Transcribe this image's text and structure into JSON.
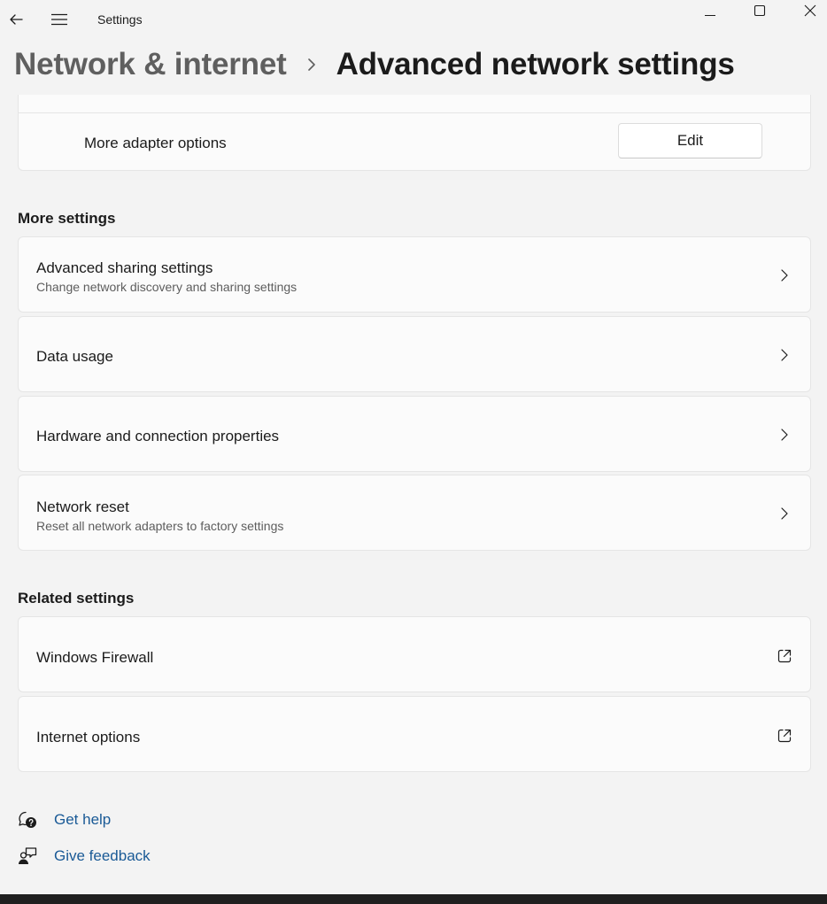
{
  "window": {
    "app_title": "Settings"
  },
  "breadcrumb": {
    "parent": "Network & internet",
    "current": "Advanced network settings"
  },
  "adapter": {
    "label": "More adapter options",
    "edit_label": "Edit"
  },
  "more_settings": {
    "heading": "More settings",
    "items": [
      {
        "title": "Advanced sharing settings",
        "subtitle": "Change network discovery and sharing settings",
        "icon": "chevron-right-icon"
      },
      {
        "title": "Data usage",
        "subtitle": "",
        "icon": "chevron-right-icon"
      },
      {
        "title": "Hardware and connection properties",
        "subtitle": "",
        "icon": "chevron-right-icon"
      },
      {
        "title": "Network reset",
        "subtitle": "Reset all network adapters to factory settings",
        "icon": "chevron-right-icon"
      }
    ]
  },
  "related_settings": {
    "heading": "Related settings",
    "items": [
      {
        "title": "Windows Firewall",
        "icon": "external-link-icon"
      },
      {
        "title": "Internet options",
        "icon": "external-link-icon"
      }
    ]
  },
  "footer": {
    "get_help": "Get help",
    "give_feedback": "Give feedback"
  },
  "colors": {
    "background": "#f3f3f3",
    "card": "#fbfbfb",
    "link": "#1a5a96",
    "border": "#e5e5e5"
  }
}
